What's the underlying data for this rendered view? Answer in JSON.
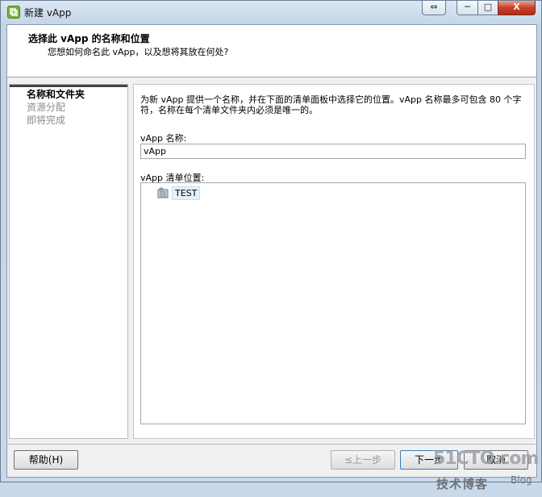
{
  "window": {
    "title": "新建 vApp",
    "close_glyph": "X",
    "min_glyph": "─",
    "max_glyph": "□",
    "sync_glyph": "⇔"
  },
  "header": {
    "title": "选择此 vApp 的名称和位置",
    "subtitle": "您想如何命名此 vApp，以及想将其放在何处?"
  },
  "steps": [
    {
      "label": "名称和文件夹",
      "active": true
    },
    {
      "label": "资源分配",
      "active": false
    },
    {
      "label": "即将完成",
      "active": false
    }
  ],
  "main": {
    "description": "为新 vApp 提供一个名称，并在下面的清单面板中选择它的位置。vApp 名称最多可包含 80 个字符，名称在每个清单文件夹内必须是唯一的。",
    "name_label": "vApp 名称:",
    "name_value": "vApp",
    "location_label": "vApp 清单位置:",
    "tree": [
      {
        "label": "TEST",
        "icon": "datacenter-icon",
        "selected": true
      }
    ]
  },
  "buttons": {
    "help": "帮助(H)",
    "back": "≤上一步",
    "next": "下一步",
    "cancel": "取消"
  },
  "watermark": {
    "site": "51CTO.com",
    "tagline": "技术博客",
    "blog": "Blog"
  },
  "colors": {
    "close_button": "#c7412b",
    "app_icon": "#7bb236",
    "selection": "#e6f1fb"
  }
}
